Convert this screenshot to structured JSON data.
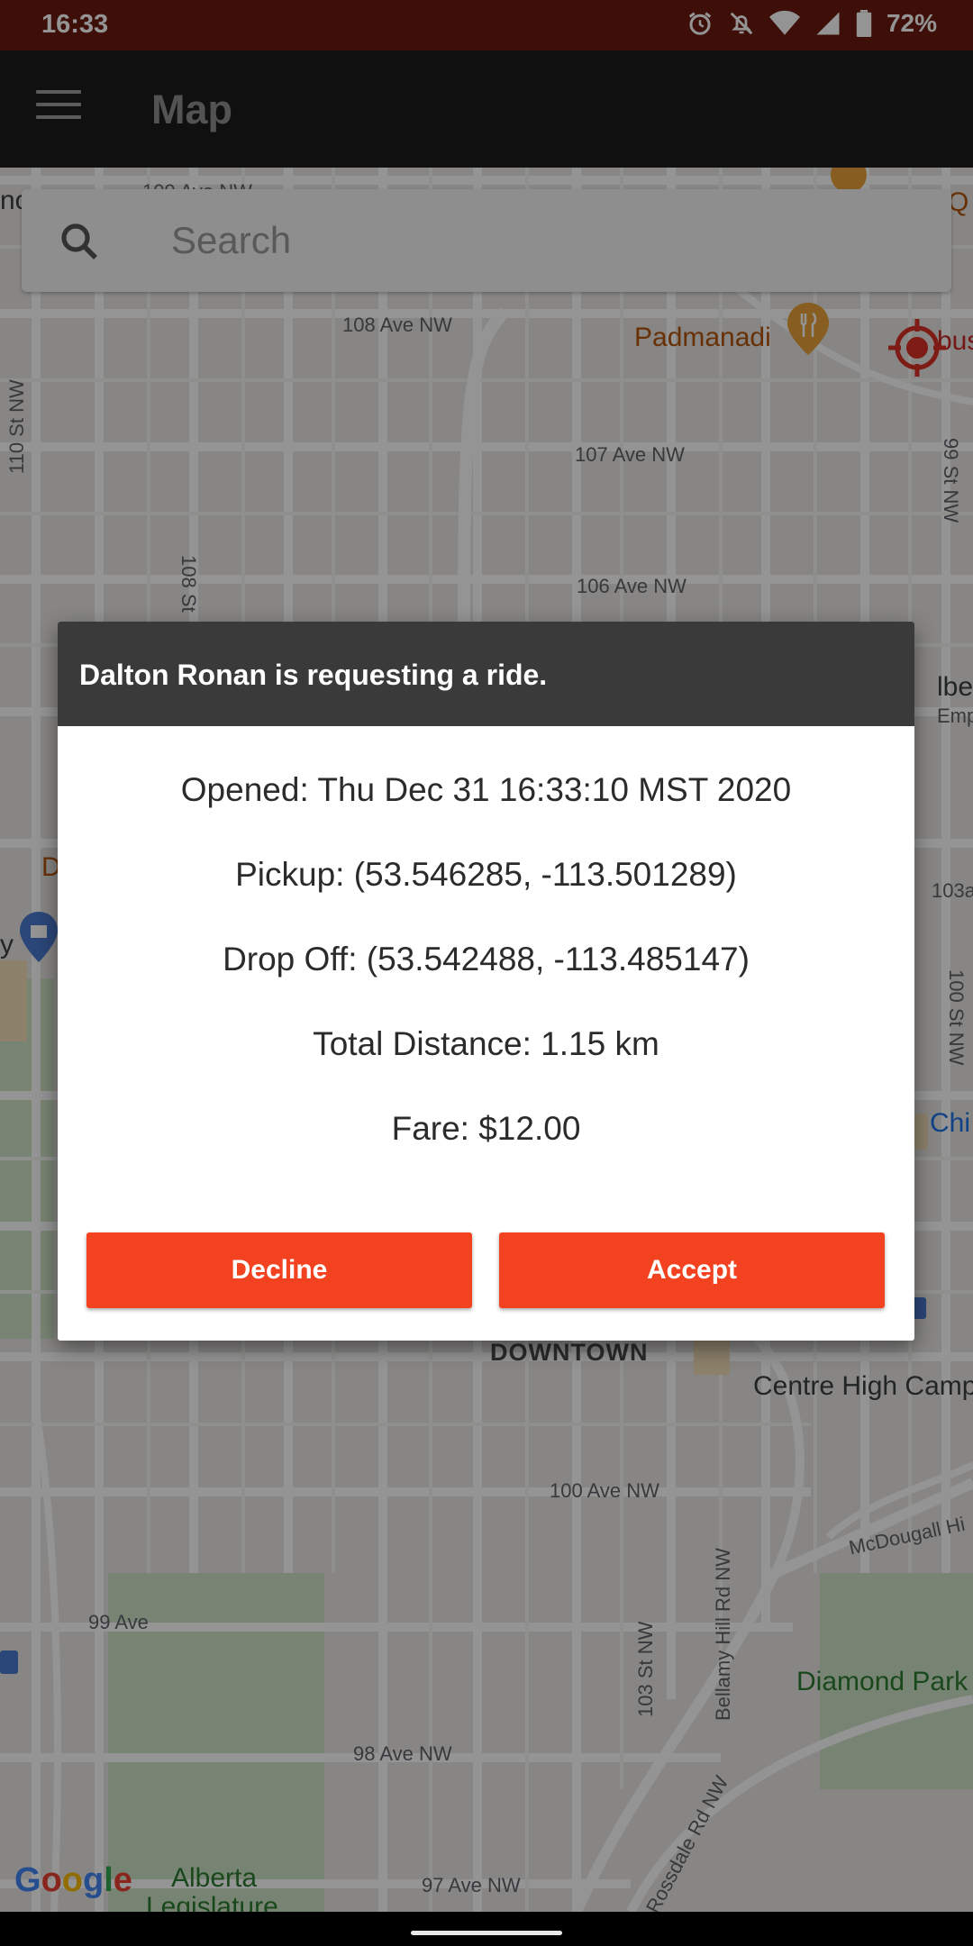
{
  "status_bar": {
    "time": "16:33",
    "battery": "72%",
    "icons": [
      "alarm-icon",
      "notifications-off-icon",
      "wifi-icon",
      "signal-icon",
      "battery-icon"
    ]
  },
  "toolbar": {
    "title": "Map",
    "menu_icon": "menu-icon"
  },
  "search": {
    "placeholder": "Search",
    "icon": "search-icon"
  },
  "map": {
    "labels": {
      "ave_108": "108 Ave NW",
      "ave_107": "107 Ave NW",
      "ave_106": "106 Ave NW",
      "ave_100": "100 Ave NW",
      "ave_99": "99 Ave",
      "ave_98": "98 Ave NW",
      "ave_97": "97 Ave NW",
      "st_110": "110 St NW",
      "st_108": "108 St",
      "st_99": "99 St NW",
      "st_100": "100 St NW",
      "st_103": "103 St NW",
      "st_103a": "103a",
      "padmanadi": "Padmanadi",
      "busky": "busky",
      "alberta_emp": "lberta",
      "emporium": "Empori",
      "chi": "Chi",
      "downtown": "DOWNTOWN",
      "centre_high": "Centre High Camp",
      "mcdougall": "McDougall Hi",
      "bellamy": "Bellamy Hill Rd NW",
      "rossdale": "Rossdale Rd NW",
      "diamond_park": "Diamond Park",
      "alberta_leg": "Alberta",
      "legislature": "Legislature",
      "top_ave": "109 Ave NW",
      "q": "Q",
      "no": "no",
      "d": "D",
      "y": "y"
    },
    "attribution": "Google",
    "accent_colors": {
      "land": "#e9e7e3",
      "road": "#ffffff",
      "park": "#cfe3c6",
      "orange": "#e8a13a",
      "target": "#d93025"
    }
  },
  "dialog": {
    "title": "Dalton Ronan is requesting a ride.",
    "lines": [
      "Opened: Thu Dec 31 16:33:10 MST 2020",
      "Pickup: (53.546285, -113.501289)",
      "Drop Off: (53.542488, -113.485147)",
      "Total Distance: 1.15 km",
      "Fare: $12.00"
    ],
    "decline_label": "Decline",
    "accept_label": "Accept",
    "accent": "#f2421f"
  }
}
